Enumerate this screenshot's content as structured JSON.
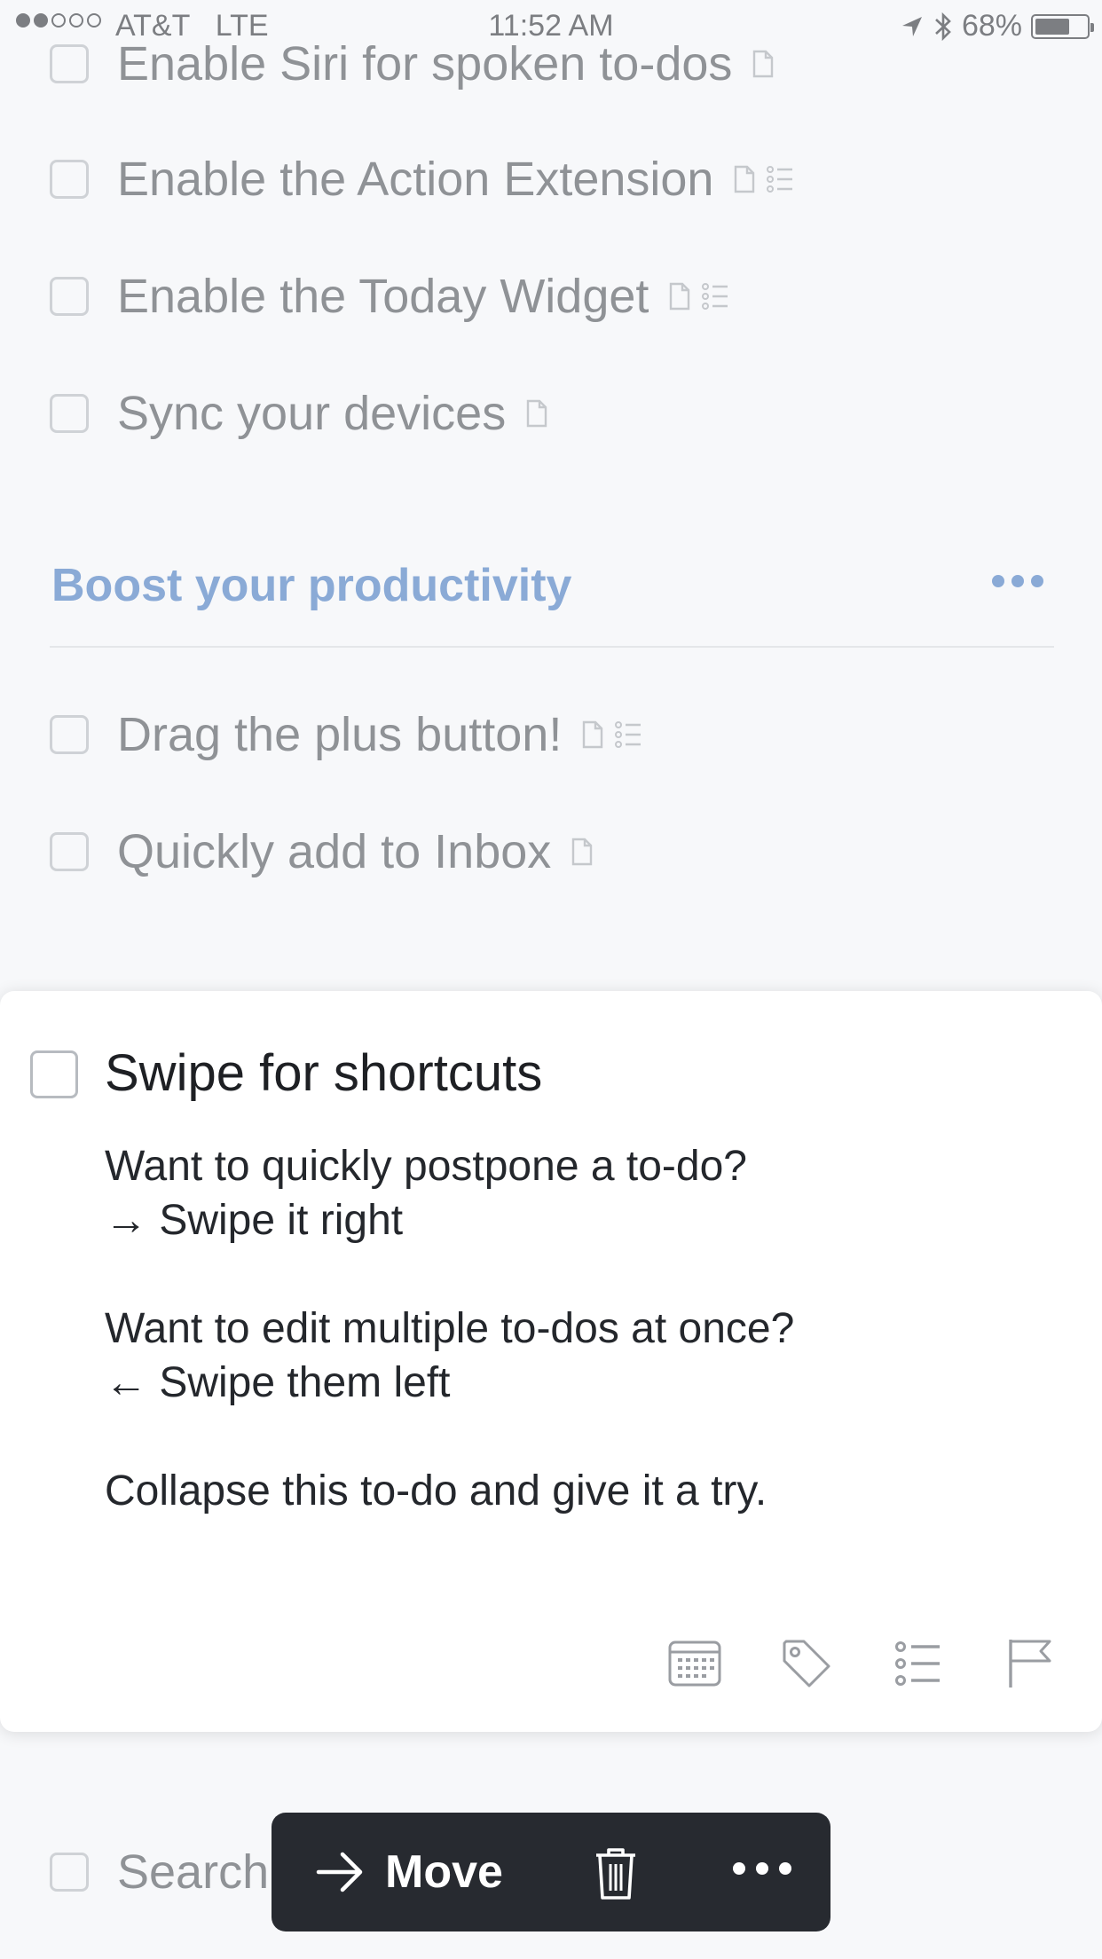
{
  "status_bar": {
    "carrier": "AT&T",
    "network": "LTE",
    "time": "11:52 AM",
    "battery": "68%"
  },
  "list": {
    "items_top": [
      {
        "label": "Enable Siri for spoken to-dos",
        "has_note": true,
        "has_checklist": false
      },
      {
        "label": "Enable the Action Extension",
        "has_note": true,
        "has_checklist": true
      },
      {
        "label": "Enable the Today Widget",
        "has_note": true,
        "has_checklist": true
      },
      {
        "label": "Sync your devices",
        "has_note": true,
        "has_checklist": false
      }
    ],
    "section": {
      "title": "Boost your productivity",
      "accent": "#8aaad6"
    },
    "items_section": [
      {
        "label": "Drag the plus button!",
        "has_note": true,
        "has_checklist": true
      },
      {
        "label": "Quickly add to Inbox",
        "has_note": true,
        "has_checklist": false
      }
    ],
    "bottom_item": {
      "label": "Search"
    }
  },
  "expanded_todo": {
    "title": "Swipe for shortcuts",
    "notes": {
      "line1": "Want to quickly postpone a to-do?",
      "line2": "→ Swipe it right",
      "line3": "Want to edit multiple to-dos at once?",
      "line4": "← Swipe them left",
      "line5": "Collapse this to-do and give it a try."
    },
    "toolbar_icons": [
      "calendar-icon",
      "tag-icon",
      "checklist-icon",
      "flag-icon"
    ]
  },
  "action_bar": {
    "move_label": "Move",
    "background": "#272a30"
  }
}
